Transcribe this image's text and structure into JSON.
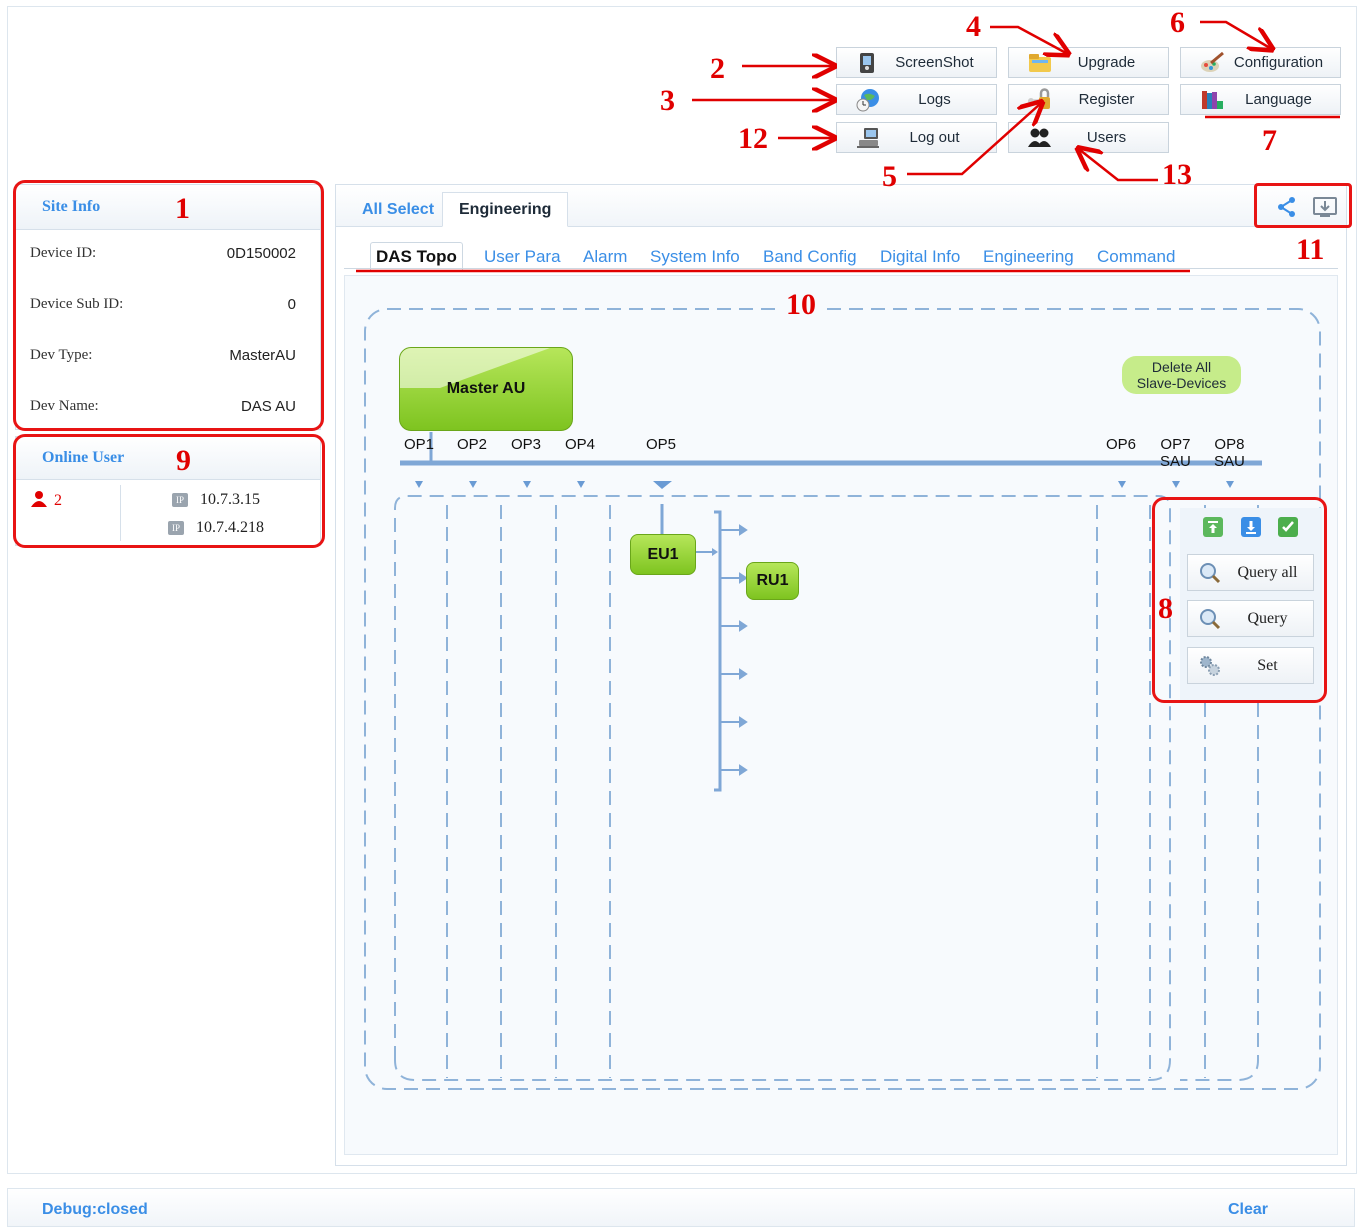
{
  "toolbar": {
    "screenshot": "ScreenShot",
    "upgrade": "Upgrade",
    "configuration": "Configuration",
    "logs": "Logs",
    "register": "Register",
    "language": "Language",
    "logout": "Log out",
    "users": "Users"
  },
  "annotations": {
    "n1": "1",
    "n2": "2",
    "n3": "3",
    "n4": "4",
    "n5": "5",
    "n6": "6",
    "n7": "7",
    "n8": "8",
    "n9": "9",
    "n10": "10",
    "n11": "11",
    "n12": "12",
    "n13": "13"
  },
  "site_info": {
    "title": "Site Info",
    "rows": [
      {
        "key": "Device ID:",
        "value": "0D150002"
      },
      {
        "key": "Device Sub ID:",
        "value": "0"
      },
      {
        "key": "Dev Type:",
        "value": "MasterAU"
      },
      {
        "key": "Dev Name:",
        "value": "DAS AU"
      }
    ]
  },
  "online_user": {
    "title": "Online User",
    "count": "2",
    "ips": [
      "10.7.3.15",
      "10.7.4.218"
    ],
    "ip_badge": "IP"
  },
  "tabs": {
    "outer": [
      "All Select",
      "Engineering"
    ],
    "inner": [
      "DAS Topo",
      "User Para",
      "Alarm",
      "System Info",
      "Band Config",
      "Digital Info",
      "Engineering",
      "Command"
    ]
  },
  "topo": {
    "master": "Master AU",
    "delete_all": "Delete All Slave-Devices",
    "delete_line1": "Delete All",
    "delete_line2": "Slave-Devices",
    "ports": [
      "OP1",
      "OP2",
      "OP3",
      "OP4",
      "OP5",
      "OP6",
      "OP7",
      "OP8"
    ],
    "port_sub": {
      "OP7": "SAU",
      "OP8": "SAU"
    },
    "eu": "EU1",
    "ru": "RU1"
  },
  "side_actions": {
    "query_all": "Query all",
    "query": "Query",
    "set": "Set"
  },
  "debug": {
    "status": "Debug:closed",
    "clear": "Clear"
  },
  "colors": {
    "accent_blue": "#3a8ee6",
    "annotation_red": "#e00000",
    "node_green": "#7ec420"
  }
}
